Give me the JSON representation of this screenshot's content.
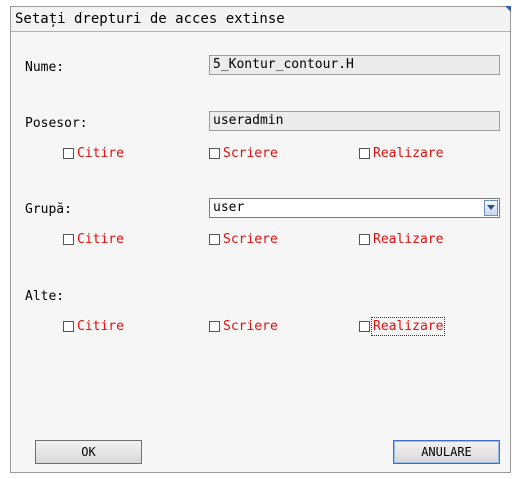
{
  "dialog": {
    "title": "Setați drepturi de acces extinse",
    "name_label": "Nume:",
    "name_value": "5_Kontur_contour.H",
    "owner_label": "Posesor:",
    "owner_value": "useradmin",
    "group_label": "Grupă:",
    "group_value": "user",
    "other_label": "Alte:",
    "perms": {
      "read": "Citire",
      "write": "Scriere",
      "execute": "Realizare"
    },
    "ok_label": "OK",
    "cancel_label": "ANULARE"
  },
  "colors": {
    "permission_text": "#e01010",
    "accent": "#2f5dbe"
  }
}
